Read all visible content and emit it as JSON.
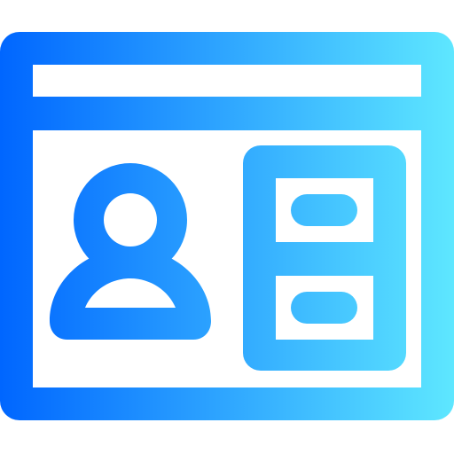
{
  "icon": {
    "name": "profile-window-icon",
    "gradient": {
      "start": "#0066ff",
      "end": "#5ee7ff"
    },
    "background": "#ffffff"
  }
}
